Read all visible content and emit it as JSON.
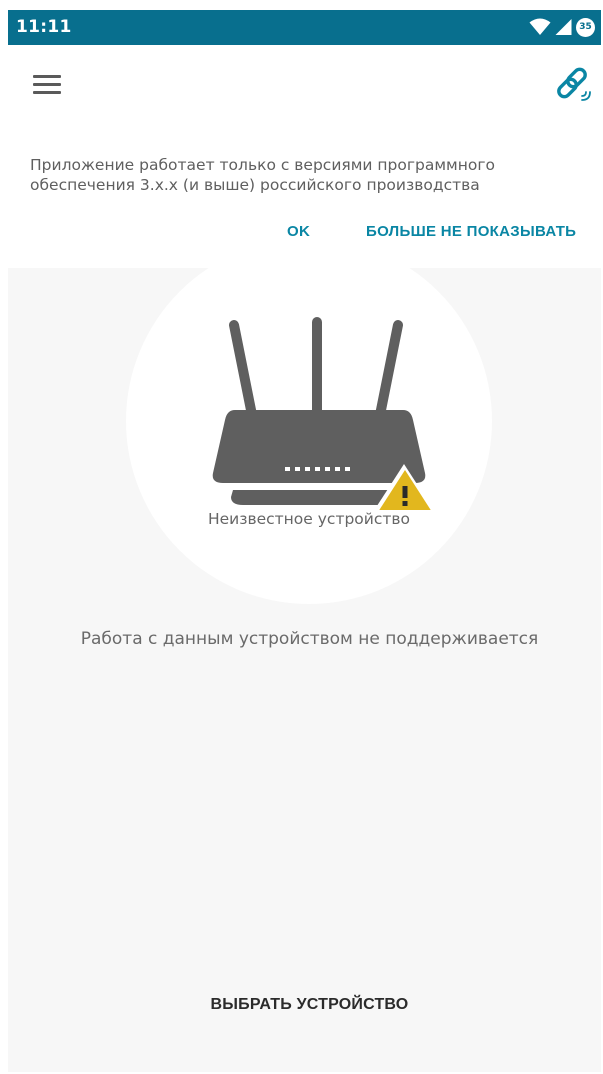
{
  "status_bar": {
    "time": "11:11",
    "battery_level": "35",
    "icons": [
      "wifi-icon",
      "cellular-signal-icon",
      "battery-icon"
    ]
  },
  "header": {
    "menu_icon": "hamburger-menu-icon",
    "link_icon": "link-icon"
  },
  "banner": {
    "message": "Приложение работает только с версиями программного обеспечения 3.x.x (и выше) российского производства",
    "ok_label": "OK",
    "dont_show_label": "БОЛЬШЕ НЕ ПОКАЗЫВАТЬ"
  },
  "device": {
    "name": "Неизвестное устройство",
    "icon": "router-icon",
    "status_icon": "warning-icon",
    "message": "Работа с данным устройством не поддерживается"
  },
  "actions": {
    "select_device_label": "ВЫБРАТЬ УСТРОЙСТВО"
  },
  "colors": {
    "status_bar": "#086f8e",
    "accent": "#0a86a4",
    "warning": "#e2b71e",
    "router": "#5f5f5f",
    "background": "#f7f7f7"
  }
}
